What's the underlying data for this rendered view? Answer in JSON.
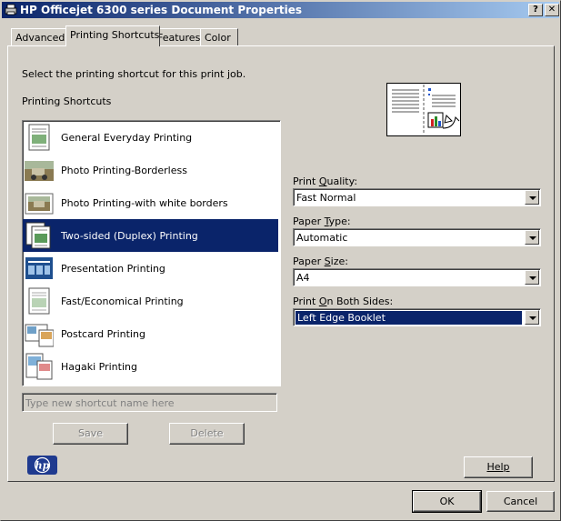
{
  "window": {
    "title": "HP Officejet 6300 series Document Properties",
    "help_glyph": "?",
    "close_glyph": "✕"
  },
  "tabs": [
    {
      "label": "Advanced"
    },
    {
      "label": "Printing Shortcuts"
    },
    {
      "label": "Features"
    },
    {
      "label": "Color"
    }
  ],
  "main": {
    "instruction": "Select the printing shortcut for this print job.",
    "list_heading": "Printing Shortcuts",
    "shortcuts": [
      {
        "label": "General Everyday Printing",
        "icon": "document-icon"
      },
      {
        "label": "Photo Printing-Borderless",
        "icon": "photo-icon"
      },
      {
        "label": "Photo Printing-with white borders",
        "icon": "photo-bordered-icon"
      },
      {
        "label": "Two-sided (Duplex) Printing",
        "icon": "duplex-icon",
        "selected": true
      },
      {
        "label": "Presentation Printing",
        "icon": "presentation-icon"
      },
      {
        "label": "Fast/Economical Printing",
        "icon": "document-icon"
      },
      {
        "label": "Postcard Printing",
        "icon": "postcard-icon"
      },
      {
        "label": "Hagaki Printing",
        "icon": "hagaki-icon"
      }
    ],
    "new_name_placeholder": "Type new shortcut name here",
    "save_label": "Save",
    "delete_label": "Delete",
    "help_label": "Help"
  },
  "options": {
    "print_quality": {
      "label_pre": "Print ",
      "label_key": "Q",
      "label_post": "uality:",
      "value": "Fast Normal"
    },
    "paper_type": {
      "label_pre": "Paper ",
      "label_key": "T",
      "label_post": "ype:",
      "value": "Automatic"
    },
    "paper_size": {
      "label_pre": "Paper ",
      "label_key": "S",
      "label_post": "ize:",
      "value": "A4"
    },
    "both_sides": {
      "label_pre": "Print ",
      "label_key": "O",
      "label_post": "n Both Sides:",
      "value": "Left Edge Booklet"
    }
  },
  "footer": {
    "ok_label": "OK",
    "cancel_label": "Cancel"
  },
  "logo": {
    "text": "hp",
    "color": "#1f3a8f"
  },
  "colors": {
    "selection": "#0a246a",
    "title_start": "#0a246a",
    "title_end": "#a6caf0"
  }
}
